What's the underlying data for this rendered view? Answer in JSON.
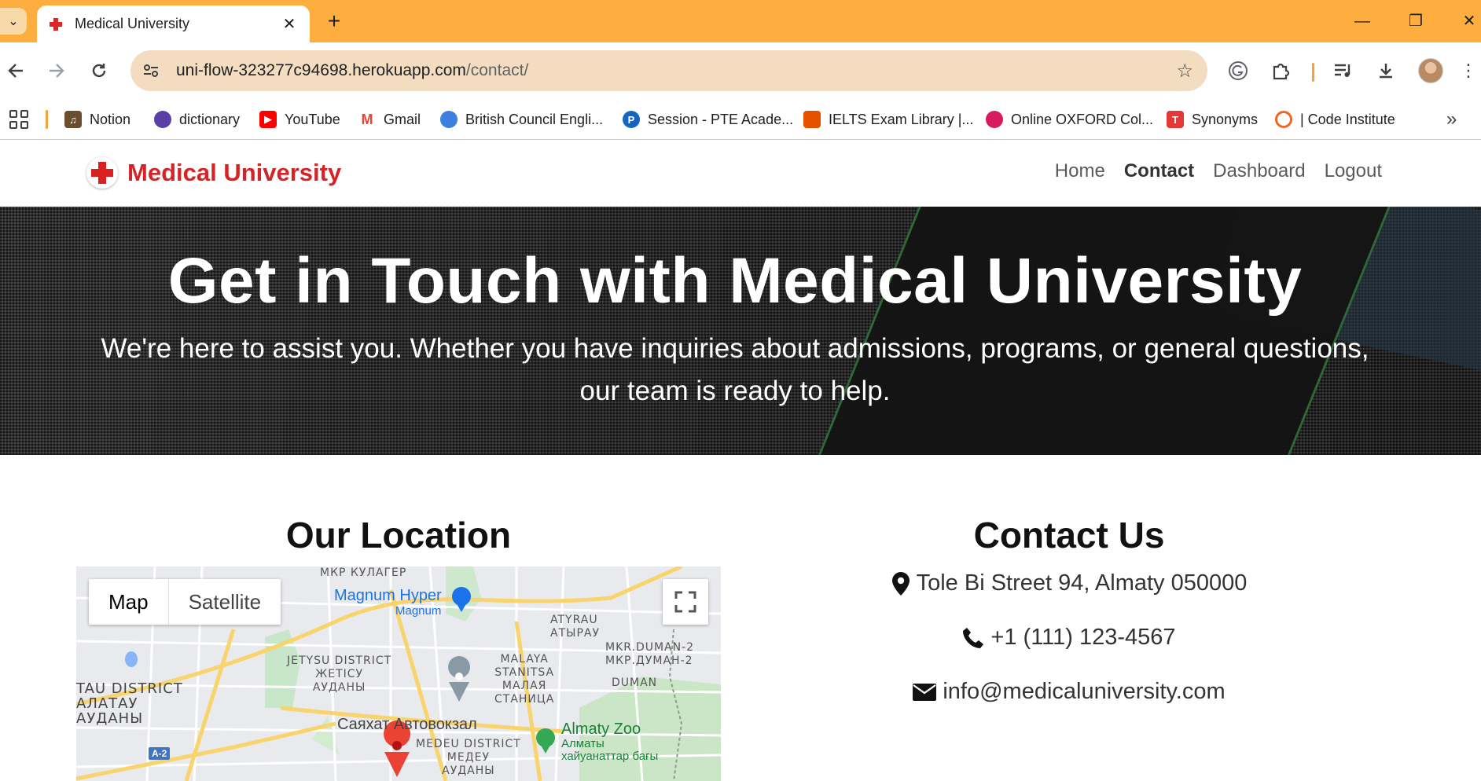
{
  "browser": {
    "tab_title": "Medical University",
    "url_host": "uni-flow-323277c94698.herokuapp.com",
    "url_path": "/contact/",
    "bookmarks": [
      {
        "label": "Notion",
        "icon": "notion-icon",
        "color": "#6B4E2E"
      },
      {
        "label": "dictionary",
        "icon": "dictionary-icon",
        "color": "#5B3FA8"
      },
      {
        "label": "YouTube",
        "icon": "youtube-icon",
        "color": "#FF0000"
      },
      {
        "label": "Gmail",
        "icon": "gmail-icon",
        "color": "#EA4335"
      },
      {
        "label": "British Council Engli...",
        "icon": "british-council-icon",
        "color": "#3D7FE0"
      },
      {
        "label": "Session - PTE Acade...",
        "icon": "pte-icon",
        "color": "#1565C0"
      },
      {
        "label": "IELTS Exam Library |...",
        "icon": "ielts-icon",
        "color": "#E65100"
      },
      {
        "label": "Online OXFORD Col...",
        "icon": "oxford-icon",
        "color": "#D81B60"
      },
      {
        "label": "Synonyms",
        "icon": "synonyms-icon",
        "color": "#E53935"
      },
      {
        "label": "| Code Institute",
        "icon": "code-institute-icon",
        "color": "#F26522"
      }
    ]
  },
  "site": {
    "brand": "Medical University",
    "nav": [
      {
        "label": "Home",
        "active": false
      },
      {
        "label": "Contact",
        "active": true
      },
      {
        "label": "Dashboard",
        "active": false
      },
      {
        "label": "Logout",
        "active": false
      }
    ]
  },
  "hero": {
    "title": "Get in Touch with Medical University",
    "subtitle": "We're here to assist you. Whether you have inquiries about admissions, programs, or general questions, our team is ready to help."
  },
  "location": {
    "title": "Our Location",
    "map_type_options": [
      "Map",
      "Satellite"
    ],
    "map_labels": {
      "mkr_kulager": "МКР КУЛАГЕР",
      "magnum_hyper": "Magnum Hyper",
      "magnum": "Magnum",
      "atyrau": "ATYRAU",
      "atyrau_cyr": "АТЫРАУ",
      "mkr_duman": "MKR.DUMAN-2",
      "mkr_duman_cyr": "МКР.ДУМАН-2",
      "duman": "DUMAN",
      "malaya_1": "MALAYA",
      "malaya_2": "STANITSA",
      "malaya_3": "МАЛАЯ",
      "malaya_4": "СТАНИЦА",
      "jetysu_1": "JETYSU DISTRICT",
      "jetysu_2": "ЖЕТІСУ",
      "jetysu_3": "АУДАНЫ",
      "tau_1": "TAU DISTRICT",
      "tau_2": "АЛАТАУ",
      "tau_3": "АУДАНЫ",
      "sayakhat": "Саяхат Автовокзал",
      "medeu_1": "MEDEU DISTRICT",
      "medeu_2": "МЕДЕУ",
      "medeu_3": "АУДАНЫ",
      "zoo": "Almaty Zoo",
      "zoo_sub_1": "Алматы",
      "zoo_sub_2": "хайуанаттар бағы",
      "road": "A-2"
    }
  },
  "contact": {
    "title": "Contact Us",
    "address": "Tole Bi Street 94, Almaty 050000",
    "phone": "+1 (111) 123-4567",
    "email": "info@medicaluniversity.com"
  },
  "colors": {
    "tabbar": "#FDAE3F",
    "brand_red": "#D42427"
  }
}
